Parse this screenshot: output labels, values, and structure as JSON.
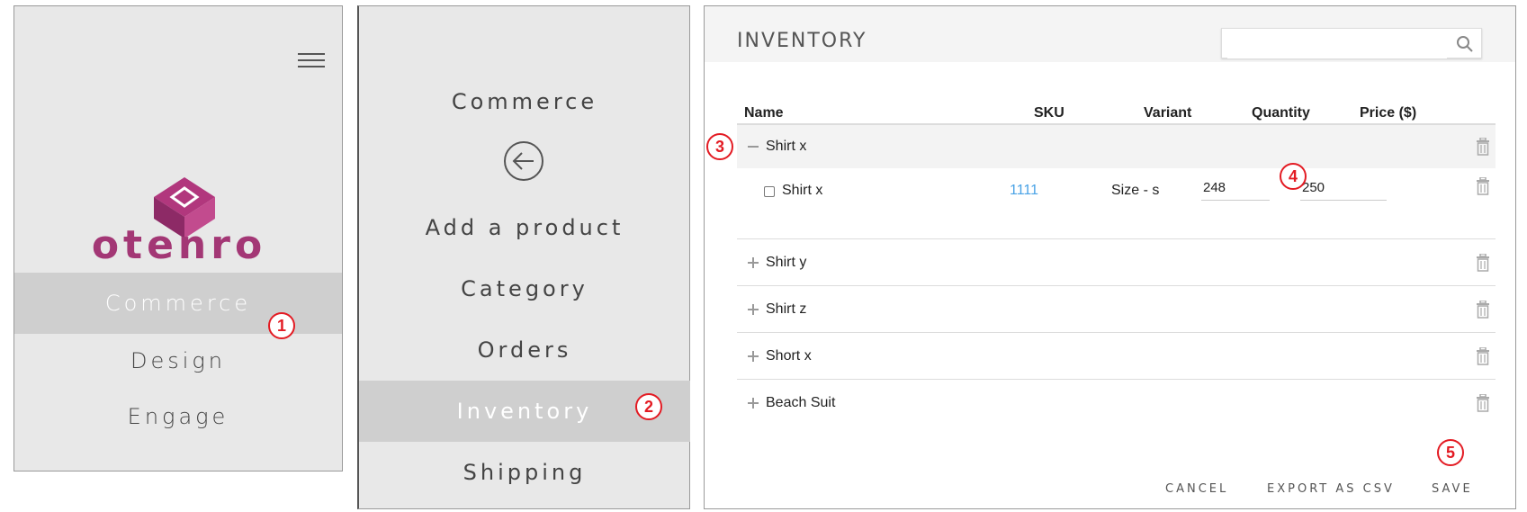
{
  "panel1": {
    "logo_text": "otenro",
    "nav_items": [
      "Commerce",
      "Design",
      "Engage"
    ],
    "active_item": "Commerce"
  },
  "panel2": {
    "header": "Commerce",
    "nav_items": [
      "Add a product",
      "Category",
      "Orders",
      "Inventory",
      "Shipping"
    ],
    "active_item": "Inventory"
  },
  "inventory": {
    "title": "INVENTORY",
    "search_placeholder": "",
    "columns": [
      "Name",
      "SKU",
      "Variant",
      "Quantity",
      "Price ($)"
    ],
    "rows": [
      {
        "name": "Shirt x",
        "expanded": true,
        "variants": [
          {
            "name": "Shirt x",
            "sku": "1111",
            "variant": "Size - s",
            "quantity": "248",
            "price": "250"
          }
        ]
      },
      {
        "name": "Shirt y",
        "expanded": false
      },
      {
        "name": "Shirt z",
        "expanded": false
      },
      {
        "name": "Short x",
        "expanded": false
      },
      {
        "name": "Beach Suit",
        "expanded": false
      }
    ],
    "actions": {
      "cancel": "CANCEL",
      "export": "EXPORT AS CSV",
      "save": "SAVE"
    }
  },
  "callouts": [
    "1",
    "2",
    "3",
    "4",
    "5"
  ],
  "colors": {
    "brand": "#a33775",
    "link": "#4aa3e6",
    "callout": "#e31b23",
    "panel_bg": "#e8e8e8",
    "active_bg": "#cfcfcf"
  }
}
